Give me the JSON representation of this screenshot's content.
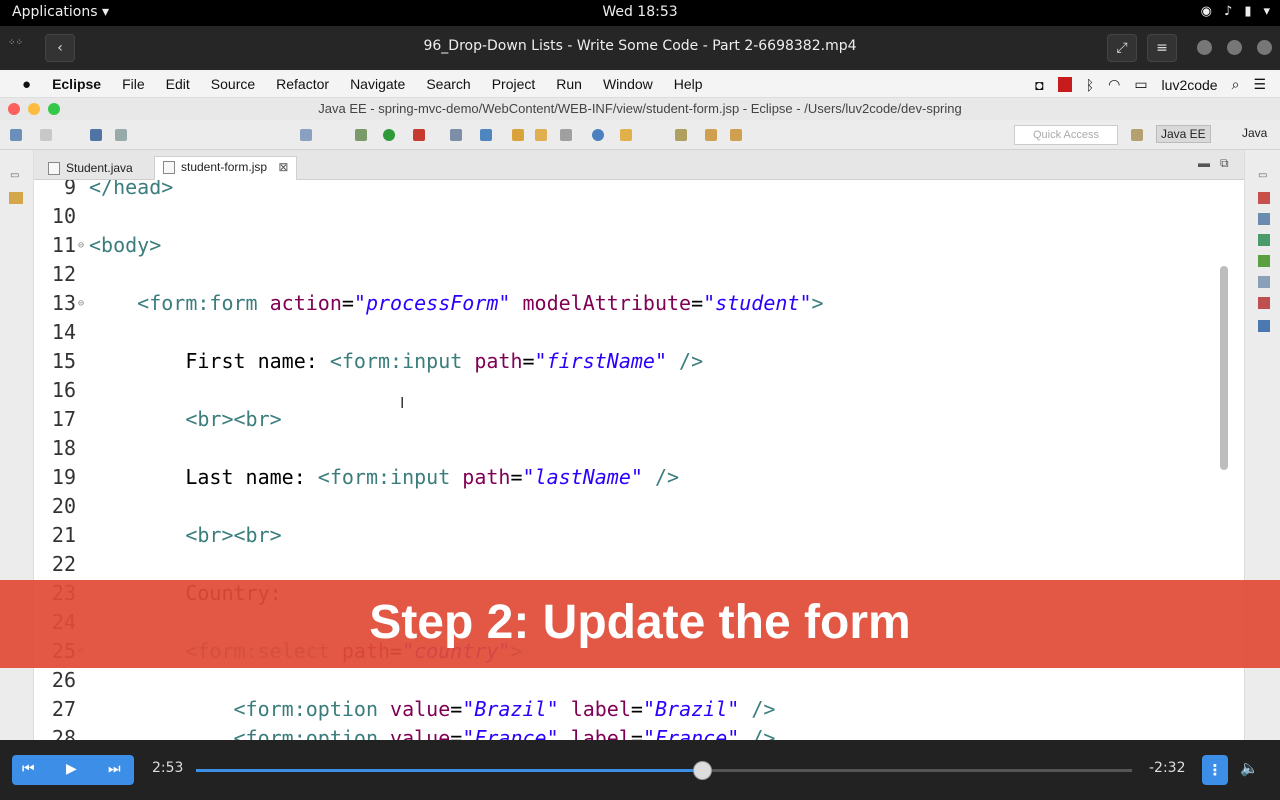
{
  "gnome_bar": {
    "apps": "Applications ▾",
    "clock": "Wed 18:53"
  },
  "player": {
    "title": "96_Drop-Down Lists - Write Some Code - Part 2-6698382.mp4",
    "current_time": "2:53",
    "remaining_time": "-2:32",
    "progress": 0.5418
  },
  "mac_menu": {
    "items": [
      "Eclipse",
      "File",
      "Edit",
      "Source",
      "Refactor",
      "Navigate",
      "Search",
      "Project",
      "Run",
      "Window",
      "Help"
    ],
    "user": "luv2code"
  },
  "window": {
    "title": "Java EE - spring-mvc-demo/WebContent/WEB-INF/view/student-form.jsp - Eclipse - /Users/luv2code/dev-spring"
  },
  "toolbar": {
    "quick_access": "Quick Access",
    "perspective_javaee": "Java EE",
    "perspective_java": "Java"
  },
  "tabs": [
    {
      "label": "Student.java"
    },
    {
      "label": "student-form.jsp"
    }
  ],
  "editor": {
    "lines": [
      {
        "n": "9",
        "tokens": [
          {
            "t": "</head>",
            "c": "tag"
          }
        ]
      },
      {
        "n": "10",
        "tokens": []
      },
      {
        "n": "11",
        "fold": true,
        "tokens": [
          {
            "t": "<body>",
            "c": "tag"
          }
        ]
      },
      {
        "n": "12",
        "tokens": []
      },
      {
        "n": "13",
        "fold": true,
        "tokens": [
          {
            "t": "    ",
            "c": "txt"
          },
          {
            "t": "<form:form ",
            "c": "tag"
          },
          {
            "t": "action",
            "c": "attr"
          },
          {
            "t": "=",
            "c": "txt"
          },
          {
            "t": "\"processForm\"",
            "c": "val"
          },
          {
            "t": " ",
            "c": "txt"
          },
          {
            "t": "modelAttribute",
            "c": "attr"
          },
          {
            "t": "=",
            "c": "txt"
          },
          {
            "t": "\"student\"",
            "c": "val"
          },
          {
            "t": ">",
            "c": "tag"
          }
        ]
      },
      {
        "n": "14",
        "tokens": []
      },
      {
        "n": "15",
        "tokens": [
          {
            "t": "        First name: ",
            "c": "txt"
          },
          {
            "t": "<form:input ",
            "c": "tag"
          },
          {
            "t": "path",
            "c": "attr"
          },
          {
            "t": "=",
            "c": "txt"
          },
          {
            "t": "\"firstName\"",
            "c": "val"
          },
          {
            "t": " />",
            "c": "tag"
          }
        ]
      },
      {
        "n": "16",
        "tokens": []
      },
      {
        "n": "17",
        "tokens": [
          {
            "t": "        ",
            "c": "txt"
          },
          {
            "t": "<br><br>",
            "c": "tag"
          }
        ]
      },
      {
        "n": "18",
        "tokens": []
      },
      {
        "n": "19",
        "tokens": [
          {
            "t": "        Last name: ",
            "c": "txt"
          },
          {
            "t": "<form:input ",
            "c": "tag"
          },
          {
            "t": "path",
            "c": "attr"
          },
          {
            "t": "=",
            "c": "txt"
          },
          {
            "t": "\"lastName\"",
            "c": "val"
          },
          {
            "t": " />",
            "c": "tag"
          }
        ]
      },
      {
        "n": "20",
        "tokens": []
      },
      {
        "n": "21",
        "tokens": [
          {
            "t": "        ",
            "c": "txt"
          },
          {
            "t": "<br><br>",
            "c": "tag"
          }
        ]
      },
      {
        "n": "22",
        "tokens": []
      },
      {
        "n": "23",
        "tokens": [
          {
            "t": "        Country:",
            "c": "txt"
          }
        ]
      },
      {
        "n": "24",
        "tokens": []
      },
      {
        "n": "25",
        "fold": true,
        "tokens": [
          {
            "t": "        ",
            "c": "txt"
          },
          {
            "t": "<form:select ",
            "c": "tag"
          },
          {
            "t": "path",
            "c": "attr"
          },
          {
            "t": "=",
            "c": "txt"
          },
          {
            "t": "\"country\"",
            "c": "val"
          },
          {
            "t": ">",
            "c": "tag"
          }
        ]
      },
      {
        "n": "26",
        "tokens": []
      },
      {
        "n": "27",
        "tokens": [
          {
            "t": "            ",
            "c": "txt"
          },
          {
            "t": "<form:option ",
            "c": "tag"
          },
          {
            "t": "value",
            "c": "attr"
          },
          {
            "t": "=",
            "c": "txt"
          },
          {
            "t": "\"Brazil\"",
            "c": "val"
          },
          {
            "t": " ",
            "c": "txt"
          },
          {
            "t": "label",
            "c": "attr"
          },
          {
            "t": "=",
            "c": "txt"
          },
          {
            "t": "\"Brazil\"",
            "c": "val"
          },
          {
            "t": " />",
            "c": "tag"
          }
        ]
      },
      {
        "n": "28",
        "tokens": [
          {
            "t": "            ",
            "c": "txt"
          },
          {
            "t": "<form:option ",
            "c": "tag"
          },
          {
            "t": "value",
            "c": "attr"
          },
          {
            "t": "=",
            "c": "txt"
          },
          {
            "t": "\"France\"",
            "c": "val"
          },
          {
            "t": " ",
            "c": "txt"
          },
          {
            "t": "label",
            "c": "attr"
          },
          {
            "t": "=",
            "c": "txt"
          },
          {
            "t": "\"France\"",
            "c": "val"
          },
          {
            "t": " />",
            "c": "tag"
          }
        ]
      }
    ]
  },
  "banner": {
    "text": "Step 2: Update the form"
  },
  "colors": {
    "accent": "#3d8ee7",
    "banner": "#e04b37",
    "tag": "#3a7d7c",
    "attribute": "#7f0055",
    "value": "#2a00ff"
  }
}
